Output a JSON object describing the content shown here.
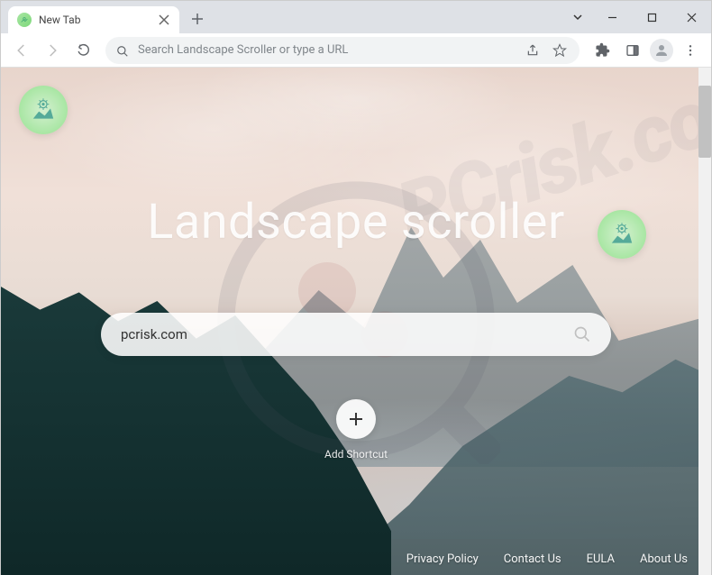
{
  "window": {
    "tab_title": "New Tab"
  },
  "toolbar": {
    "omnibox_placeholder": "Search Landscape Scroller or type a URL"
  },
  "page": {
    "hero_title": "Landscape scroller",
    "search_value": "pcrisk.com",
    "add_shortcut_label": "Add Shortcut"
  },
  "footer": {
    "links": [
      "Privacy Policy",
      "Contact Us",
      "EULA",
      "About Us"
    ]
  },
  "icons": {
    "tab_close": "close-icon",
    "new_tab": "plus-icon",
    "minimize": "minimize-icon",
    "maximize": "maximize-icon",
    "window_close": "close-icon",
    "back": "arrow-left-icon",
    "forward": "arrow-right-icon",
    "reload": "reload-icon",
    "omnibox_search": "search-icon",
    "share": "share-icon",
    "bookmark": "star-icon",
    "extensions": "puzzle-icon",
    "side_panel": "panel-icon",
    "profile": "person-icon",
    "menu": "more-vert-icon"
  },
  "colors": {
    "accent_green": "#a8e6a3",
    "chrome_grey": "#dee1e6"
  }
}
